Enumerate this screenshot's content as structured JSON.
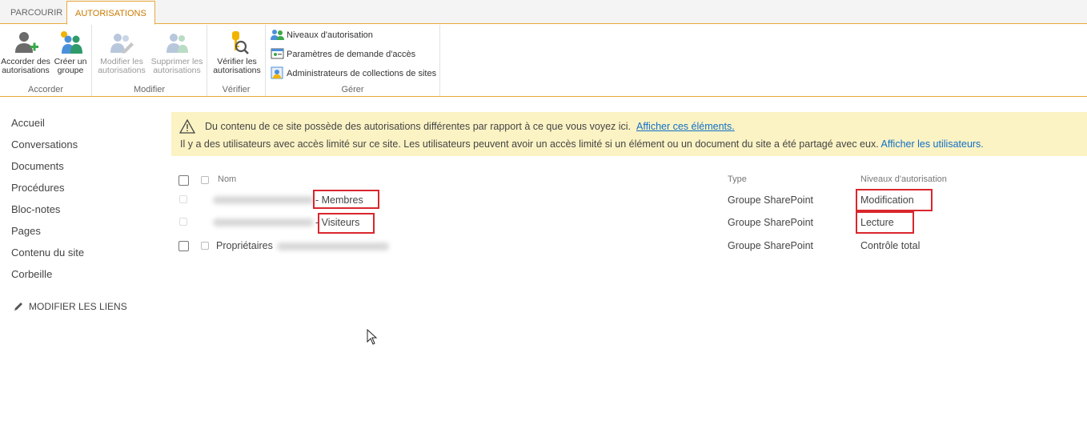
{
  "tabs": {
    "browse": "PARCOURIR",
    "permissions": "AUTORISATIONS"
  },
  "ribbon": {
    "grant": {
      "label": "Accorder",
      "grant_button": {
        "line1": "Accorder des",
        "line2": "autorisations"
      },
      "create_group_button": {
        "line1": "Créer un",
        "line2": "groupe"
      }
    },
    "modify": {
      "label": "Modifier",
      "edit_button": {
        "line1": "Modifier les",
        "line2": "autorisations"
      },
      "remove_button": {
        "line1": "Supprimer les",
        "line2": "autorisations"
      }
    },
    "check": {
      "label": "Vérifier",
      "check_button": {
        "line1": "Vérifier les",
        "line2": "autorisations"
      }
    },
    "manage": {
      "label": "Gérer",
      "items": [
        "Niveaux d'autorisation",
        "Paramètres de demande d'accès",
        "Administrateurs de collections de sites"
      ]
    }
  },
  "nav": {
    "items": [
      "Accueil",
      "Conversations",
      "Documents",
      "Procédures",
      "Bloc-notes",
      "Pages",
      "Contenu du site",
      "Corbeille"
    ],
    "edit_links": "MODIFIER LES LIENS"
  },
  "banner": {
    "line1_text": "Du contenu de ce site possède des autorisations différentes par rapport à ce que vous voyez ici.",
    "line1_link": "Afficher ces éléments.",
    "line2_text": "Il y a des utilisateurs avec accès limité sur ce site. Les utilisateurs peuvent avoir un accès limité si un élément ou un document du site a été partagé avec eux.",
    "line2_link": "Afficher les utilisateurs."
  },
  "table": {
    "headers": {
      "name": "Nom",
      "type": "Type",
      "level": "Niveaux d'autorisation"
    },
    "rows": [
      {
        "name_suffix": "Membres",
        "type": "Groupe SharePoint",
        "level": "Modification"
      },
      {
        "name_suffix": "Visiteurs",
        "type": "Groupe SharePoint",
        "level": "Lecture"
      },
      {
        "name_prefix": "Propriétaires",
        "type": "Groupe SharePoint",
        "level": "Contrôle total"
      }
    ]
  },
  "colors": {
    "accent": "#e8a93b",
    "tab_active_text": "#c87a00",
    "link": "#0f6fc6",
    "banner_bg": "#fcf3c4",
    "highlight": "#d9262d"
  }
}
